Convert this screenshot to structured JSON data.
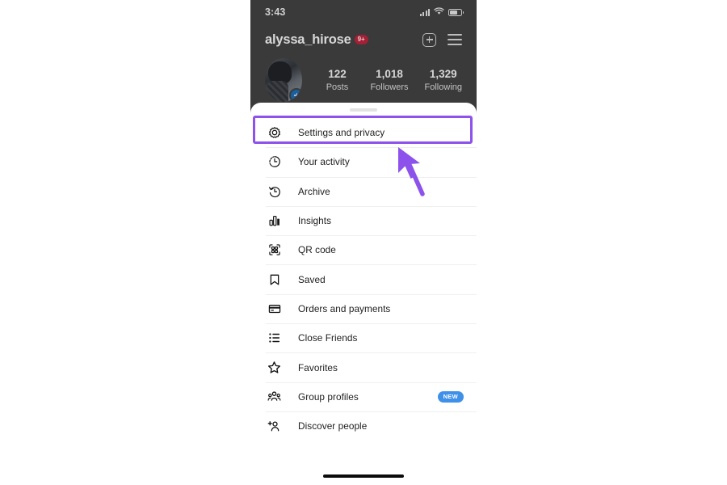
{
  "status_bar": {
    "time": "3:43",
    "icons": [
      "signal-bars-icon",
      "wifi-icon",
      "battery-icon"
    ]
  },
  "profile_header": {
    "username": "alyssa_hirose",
    "username_badge": "9+",
    "actions": [
      {
        "name": "add-post-button",
        "icon": "plus-square-icon"
      },
      {
        "name": "menu-button",
        "icon": "hamburger-icon"
      }
    ],
    "avatar": {
      "icon": "avatar",
      "add_story_icon": "plus-icon"
    },
    "stats": [
      {
        "value": "122",
        "label": "Posts"
      },
      {
        "value": "1,018",
        "label": "Followers"
      },
      {
        "value": "1,329",
        "label": "Following"
      }
    ]
  },
  "sheet": {
    "handle": "drag-handle",
    "menu_items": [
      {
        "label": "Settings and privacy",
        "icon": "gear-icon",
        "highlighted": true
      },
      {
        "label": "Your activity",
        "icon": "activity-clock-icon"
      },
      {
        "label": "Archive",
        "icon": "archive-clock-icon"
      },
      {
        "label": "Insights",
        "icon": "insights-bar-chart-icon"
      },
      {
        "label": "QR code",
        "icon": "qr-code-icon"
      },
      {
        "label": "Saved",
        "icon": "bookmark-icon"
      },
      {
        "label": "Orders and payments",
        "icon": "credit-card-icon"
      },
      {
        "label": "Close Friends",
        "icon": "list-icon"
      },
      {
        "label": "Favorites",
        "icon": "star-icon"
      },
      {
        "label": "Group profiles",
        "icon": "group-people-icon",
        "badge": "NEW"
      },
      {
        "label": "Discover people",
        "icon": "add-person-icon"
      }
    ]
  },
  "annotation": {
    "highlight_color": "#8c52eb",
    "cursor_icon": "arrow-cursor",
    "cursor_color": "#8c52eb"
  },
  "home_indicator": "home-indicator"
}
